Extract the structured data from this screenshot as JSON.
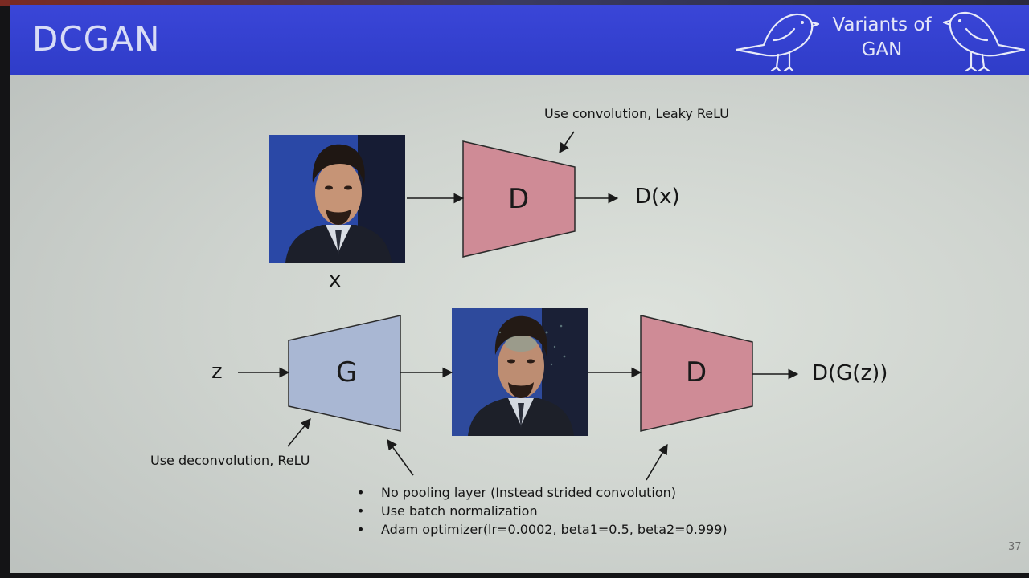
{
  "slide": {
    "title": "DCGAN",
    "badge": {
      "line1": "Variants of",
      "line2": "GAN"
    },
    "page_number": "37"
  },
  "diagram": {
    "top_row": {
      "input_label": "x",
      "discriminator_label": "D",
      "output_label": "D(x)",
      "annotation": "Use convolution, Leaky ReLU"
    },
    "bottom_row": {
      "input_label": "z",
      "generator_label": "G",
      "discriminator_label": "D",
      "output_label": "D(G(z))",
      "generator_annotation": "Use deconvolution, ReLU"
    },
    "notes": [
      "No pooling layer (Instead strided convolution)",
      "Use batch normalization",
      "Adam optimizer(lr=0.0002, beta1=0.5, beta2=0.999)"
    ],
    "colors": {
      "discriminator": "#cf8b96",
      "generator": "#a9b7d3",
      "header": "#2f3cc8"
    }
  }
}
